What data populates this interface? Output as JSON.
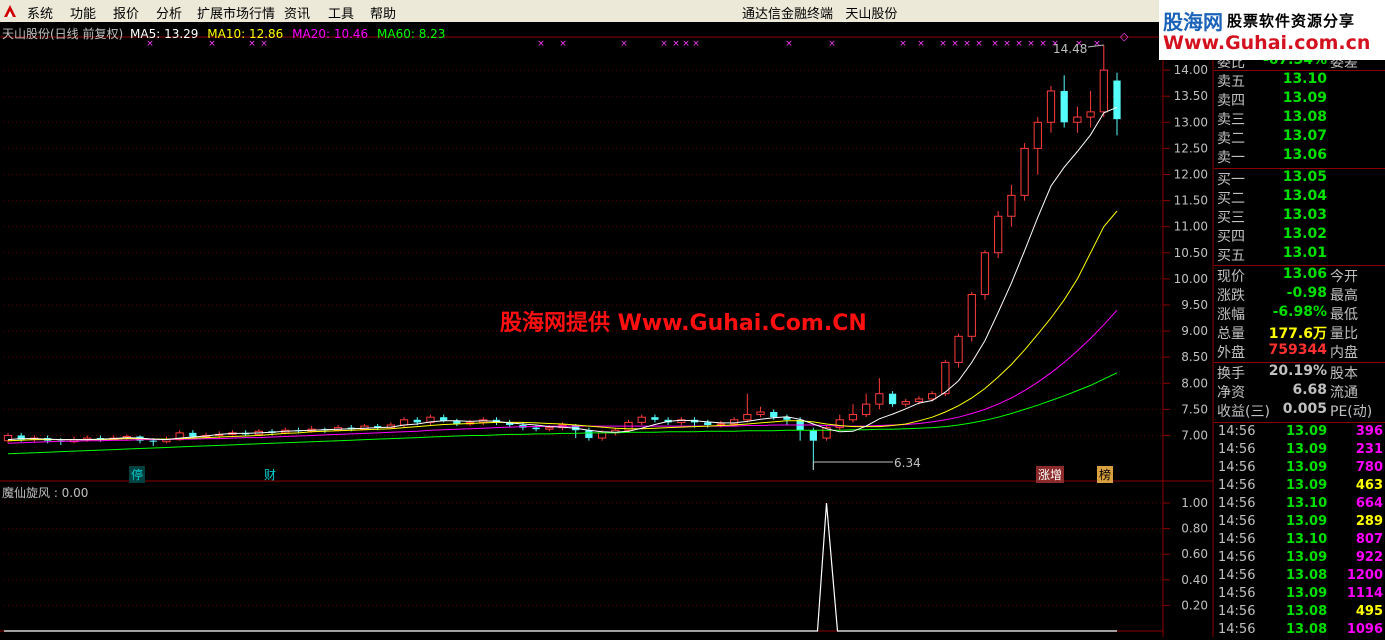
{
  "menu": {
    "items": [
      "系统",
      "功能",
      "报价",
      "分析",
      "扩展市场行情",
      "资讯",
      "工具",
      "帮助"
    ],
    "app_title": "通达信金融终端",
    "stock_name": "天山股份"
  },
  "brand": {
    "line1": "股海网",
    "line2": "股票软件资源分享",
    "line3": "Www.Guhai.com.cn"
  },
  "watermark": "股海网提供 Www.Guhai.Com.CN",
  "chart_header": {
    "title": "天山股份(日线 前复权)",
    "ma5": "MA5: 13.29",
    "ma10": "MA10: 12.86",
    "ma20": "MA20: 10.46",
    "ma60": "MA60: 8.23",
    "ma5_color": "#ffffff",
    "ma10_color": "#ffff00",
    "ma20_color": "#ff00ff",
    "ma60_color": "#00ff00"
  },
  "annotations": {
    "high": "14.48",
    "low": "6.34",
    "tag_ting": "停",
    "tag_cai": "财",
    "tag_zhangzeng": "涨增",
    "tag_bang": "榜"
  },
  "indicator": {
    "title": "魔仙旋风 : 0.00"
  },
  "chart_data": {
    "type": "candlestick",
    "y_axis_price": [
      "14.00",
      "13.50",
      "13.00",
      "12.50",
      "12.00",
      "11.50",
      "11.00",
      "10.50",
      "10.00",
      "9.50",
      "9.00",
      "8.50",
      "8.00",
      "7.50",
      "7.00"
    ],
    "y_axis_indicator": [
      "1.00",
      "0.80",
      "0.60",
      "0.40",
      "0.20"
    ],
    "price_range": [
      6.3,
      14.5
    ],
    "indicator_range": [
      0,
      1.0
    ],
    "candles": [
      [
        6.9,
        7.0,
        6.85,
        7.05
      ],
      [
        7.0,
        6.92,
        6.88,
        7.05
      ],
      [
        6.92,
        6.95,
        6.88,
        7.0
      ],
      [
        6.95,
        6.9,
        6.85,
        7.0
      ],
      [
        6.9,
        6.88,
        6.82,
        6.95
      ],
      [
        6.88,
        6.92,
        6.85,
        6.98
      ],
      [
        6.92,
        6.95,
        6.88,
        7.0
      ],
      [
        6.95,
        6.92,
        6.88,
        7.0
      ],
      [
        6.92,
        6.95,
        6.9,
        7.0
      ],
      [
        6.95,
        6.98,
        6.9,
        7.02
      ],
      [
        6.98,
        6.9,
        6.85,
        7.0
      ],
      [
        6.9,
        6.88,
        6.8,
        6.95
      ],
      [
        6.88,
        6.92,
        6.85,
        6.98
      ],
      [
        6.92,
        7.05,
        6.9,
        7.1
      ],
      [
        7.05,
        6.98,
        6.95,
        7.1
      ],
      [
        6.98,
        7.0,
        6.95,
        7.05
      ],
      [
        7.0,
        7.02,
        6.95,
        7.08
      ],
      [
        7.02,
        7.05,
        7.0,
        7.1
      ],
      [
        7.05,
        7.02,
        6.98,
        7.1
      ],
      [
        7.02,
        7.08,
        7.0,
        7.12
      ],
      [
        7.08,
        7.05,
        7.0,
        7.12
      ],
      [
        7.05,
        7.1,
        7.02,
        7.15
      ],
      [
        7.1,
        7.08,
        7.05,
        7.15
      ],
      [
        7.08,
        7.12,
        7.05,
        7.18
      ],
      [
        7.12,
        7.1,
        7.05,
        7.15
      ],
      [
        7.1,
        7.15,
        7.08,
        7.2
      ],
      [
        7.15,
        7.12,
        7.08,
        7.2
      ],
      [
        7.12,
        7.18,
        7.1,
        7.22
      ],
      [
        7.18,
        7.15,
        7.1,
        7.22
      ],
      [
        7.15,
        7.2,
        7.12,
        7.25
      ],
      [
        7.2,
        7.3,
        7.15,
        7.35
      ],
      [
        7.3,
        7.25,
        7.2,
        7.35
      ],
      [
        7.25,
        7.35,
        7.2,
        7.4
      ],
      [
        7.35,
        7.28,
        7.25,
        7.4
      ],
      [
        7.28,
        7.22,
        7.18,
        7.32
      ],
      [
        7.22,
        7.25,
        7.18,
        7.3
      ],
      [
        7.25,
        7.3,
        7.2,
        7.35
      ],
      [
        7.3,
        7.25,
        7.2,
        7.35
      ],
      [
        7.25,
        7.2,
        7.15,
        7.3
      ],
      [
        7.2,
        7.15,
        7.1,
        7.25
      ],
      [
        7.15,
        7.12,
        7.08,
        7.2
      ],
      [
        7.12,
        7.15,
        7.08,
        7.2
      ],
      [
        7.15,
        7.2,
        7.1,
        7.25
      ],
      [
        7.2,
        7.1,
        6.95,
        7.22
      ],
      [
        7.1,
        6.95,
        6.9,
        7.15
      ],
      [
        6.95,
        7.05,
        6.9,
        7.1
      ],
      [
        7.05,
        7.1,
        7.0,
        7.15
      ],
      [
        7.1,
        7.25,
        7.05,
        7.3
      ],
      [
        7.25,
        7.35,
        7.2,
        7.4
      ],
      [
        7.35,
        7.3,
        7.25,
        7.4
      ],
      [
        7.3,
        7.25,
        7.2,
        7.35
      ],
      [
        7.25,
        7.3,
        7.2,
        7.35
      ],
      [
        7.3,
        7.25,
        7.15,
        7.35
      ],
      [
        7.25,
        7.2,
        7.15,
        7.3
      ],
      [
        7.2,
        7.22,
        7.15,
        7.28
      ],
      [
        7.22,
        7.3,
        7.18,
        7.35
      ],
      [
        7.3,
        7.4,
        7.25,
        7.8
      ],
      [
        7.4,
        7.45,
        7.35,
        7.55
      ],
      [
        7.45,
        7.35,
        7.3,
        7.5
      ],
      [
        7.35,
        7.3,
        7.2,
        7.4
      ],
      [
        7.3,
        7.1,
        6.9,
        7.35
      ],
      [
        7.1,
        6.9,
        6.34,
        7.15
      ],
      [
        6.95,
        7.15,
        6.9,
        7.2
      ],
      [
        7.15,
        7.3,
        7.1,
        7.4
      ],
      [
        7.3,
        7.4,
        7.25,
        7.6
      ],
      [
        7.4,
        7.6,
        7.35,
        7.8
      ],
      [
        7.6,
        7.8,
        7.5,
        8.1
      ],
      [
        7.8,
        7.6,
        7.55,
        7.85
      ],
      [
        7.6,
        7.65,
        7.55,
        7.7
      ],
      [
        7.65,
        7.7,
        7.6,
        7.75
      ],
      [
        7.7,
        7.8,
        7.65,
        7.85
      ],
      [
        7.8,
        8.4,
        7.75,
        8.45
      ],
      [
        8.4,
        8.9,
        8.3,
        8.95
      ],
      [
        8.9,
        9.7,
        8.8,
        9.75
      ],
      [
        9.7,
        10.5,
        9.6,
        10.55
      ],
      [
        10.5,
        11.2,
        10.4,
        11.3
      ],
      [
        11.2,
        11.6,
        11.0,
        11.8
      ],
      [
        11.6,
        12.5,
        11.5,
        12.6
      ],
      [
        12.5,
        13.0,
        12.0,
        13.1
      ],
      [
        13.0,
        13.6,
        12.8,
        13.7
      ],
      [
        13.6,
        13.0,
        12.9,
        13.9
      ],
      [
        13.0,
        13.1,
        12.8,
        13.3
      ],
      [
        13.1,
        13.2,
        12.9,
        13.6
      ],
      [
        13.2,
        14.0,
        13.1,
        14.48
      ],
      [
        13.8,
        13.06,
        12.75,
        13.95
      ]
    ],
    "ma5": [
      6.92,
      6.94,
      6.94,
      6.93,
      6.92,
      6.92,
      6.92,
      6.93,
      6.94,
      6.96,
      6.95,
      6.93,
      6.92,
      6.95,
      6.97,
      6.99,
      7.02,
      7.04,
      7.04,
      7.05,
      7.06,
      7.08,
      7.09,
      7.1,
      7.11,
      7.12,
      7.13,
      7.14,
      7.15,
      7.16,
      7.2,
      7.22,
      7.26,
      7.28,
      7.28,
      7.27,
      7.28,
      7.27,
      7.24,
      7.22,
      7.2,
      7.17,
      7.16,
      7.14,
      7.1,
      7.07,
      7.06,
      7.08,
      7.14,
      7.21,
      7.27,
      7.29,
      7.28,
      7.26,
      7.24,
      7.24,
      7.27,
      7.31,
      7.34,
      7.36,
      7.31,
      7.22,
      7.13,
      7.07,
      7.08,
      7.18,
      7.32,
      7.41,
      7.51,
      7.62,
      7.67,
      7.83,
      8.05,
      8.4,
      8.82,
      9.36,
      9.92,
      10.54,
      11.18,
      11.78,
      12.14,
      12.44,
      12.76,
      13.18,
      13.29
    ],
    "ma10": [
      6.9,
      6.91,
      6.92,
      6.92,
      6.92,
      6.92,
      6.92,
      6.92,
      6.93,
      6.94,
      6.94,
      6.93,
      6.93,
      6.94,
      6.95,
      6.96,
      6.97,
      6.98,
      6.99,
      7.0,
      7.02,
      7.04,
      7.05,
      7.07,
      7.08,
      7.09,
      7.1,
      7.11,
      7.12,
      7.13,
      7.15,
      7.17,
      7.19,
      7.21,
      7.22,
      7.23,
      7.24,
      7.25,
      7.25,
      7.25,
      7.24,
      7.23,
      7.22,
      7.2,
      7.18,
      7.16,
      7.14,
      7.13,
      7.13,
      7.14,
      7.15,
      7.16,
      7.17,
      7.18,
      7.19,
      7.2,
      7.22,
      7.24,
      7.26,
      7.28,
      7.28,
      7.26,
      7.22,
      7.19,
      7.17,
      7.17,
      7.17,
      7.19,
      7.22,
      7.28,
      7.35,
      7.45,
      7.57,
      7.72,
      7.9,
      8.12,
      8.36,
      8.64,
      8.94,
      9.25,
      9.6,
      10.0,
      10.5,
      11.0,
      11.3
    ],
    "ma20": [
      6.85,
      6.86,
      6.87,
      6.88,
      6.89,
      6.89,
      6.9,
      6.9,
      6.91,
      6.91,
      6.92,
      6.92,
      6.92,
      6.93,
      6.93,
      6.94,
      6.94,
      6.95,
      6.96,
      6.96,
      6.97,
      6.98,
      6.99,
      7.0,
      7.01,
      7.02,
      7.03,
      7.04,
      7.05,
      7.06,
      7.07,
      7.08,
      7.1,
      7.11,
      7.12,
      7.13,
      7.14,
      7.15,
      7.16,
      7.17,
      7.17,
      7.18,
      7.18,
      7.18,
      7.18,
      7.18,
      7.18,
      7.18,
      7.18,
      7.18,
      7.18,
      7.18,
      7.18,
      7.18,
      7.18,
      7.18,
      7.19,
      7.19,
      7.2,
      7.2,
      7.2,
      7.2,
      7.19,
      7.18,
      7.18,
      7.18,
      7.19,
      7.2,
      7.21,
      7.23,
      7.26,
      7.3,
      7.35,
      7.42,
      7.5,
      7.6,
      7.72,
      7.86,
      8.02,
      8.2,
      8.4,
      8.62,
      8.86,
      9.12,
      9.4
    ],
    "ma60": [
      6.65,
      6.66,
      6.67,
      6.68,
      6.69,
      6.7,
      6.71,
      6.72,
      6.73,
      6.74,
      6.75,
      6.76,
      6.77,
      6.78,
      6.79,
      6.8,
      6.81,
      6.82,
      6.83,
      6.84,
      6.85,
      6.86,
      6.87,
      6.88,
      6.89,
      6.9,
      6.91,
      6.92,
      6.93,
      6.94,
      6.95,
      6.96,
      6.97,
      6.98,
      6.99,
      7.0,
      7.0,
      7.01,
      7.02,
      7.02,
      7.03,
      7.03,
      7.04,
      7.04,
      7.05,
      7.05,
      7.05,
      7.06,
      7.06,
      7.06,
      7.07,
      7.07,
      7.07,
      7.08,
      7.08,
      7.08,
      7.09,
      7.09,
      7.09,
      7.1,
      7.1,
      7.1,
      7.1,
      7.1,
      7.11,
      7.11,
      7.12,
      7.12,
      7.13,
      7.14,
      7.15,
      7.17,
      7.2,
      7.24,
      7.29,
      7.35,
      7.42,
      7.5,
      7.58,
      7.67,
      7.76,
      7.86,
      7.96,
      8.08,
      8.2
    ],
    "indicator": [
      0,
      0,
      0,
      0,
      0,
      0,
      0,
      0,
      0,
      0,
      0,
      0,
      0,
      0,
      0,
      0,
      0,
      0,
      0,
      0,
      0,
      0,
      0,
      0,
      0,
      0,
      0,
      0,
      0,
      0,
      0,
      0,
      0,
      0,
      0,
      0,
      0,
      0,
      0,
      0,
      0,
      0,
      0,
      0,
      0,
      0,
      0,
      0,
      0,
      0,
      0,
      0,
      0,
      0,
      0,
      0,
      0,
      0,
      0,
      0,
      0,
      0,
      0,
      0,
      0,
      0,
      0,
      0,
      0,
      0,
      0,
      0,
      0,
      0,
      0,
      0,
      0,
      0,
      0,
      0,
      1,
      0,
      0,
      0,
      0
    ],
    "indicator_peak_index": 62
  },
  "quote": {
    "weibi": {
      "label": "委比",
      "value": "-67.54%",
      "right": "委差",
      "color": "#00e000"
    },
    "asks": [
      {
        "label": "卖五",
        "value": "13.10"
      },
      {
        "label": "卖四",
        "value": "13.09"
      },
      {
        "label": "卖三",
        "value": "13.08"
      },
      {
        "label": "卖二",
        "value": "13.07"
      },
      {
        "label": "卖一",
        "value": "13.06"
      }
    ],
    "bids": [
      {
        "label": "买一",
        "value": "13.05"
      },
      {
        "label": "买二",
        "value": "13.04"
      },
      {
        "label": "买三",
        "value": "13.03"
      },
      {
        "label": "买四",
        "value": "13.02"
      },
      {
        "label": "买五",
        "value": "13.01"
      }
    ],
    "stats1": [
      {
        "label": "现价",
        "value": "13.06",
        "right": "今开",
        "color": "#00e000"
      },
      {
        "label": "涨跌",
        "value": "-0.98",
        "right": "最高",
        "color": "#00e000"
      },
      {
        "label": "涨幅",
        "value": "-6.98%",
        "right": "最低",
        "color": "#00e000"
      },
      {
        "label": "总量",
        "value": "177.6万",
        "right": "量比",
        "color": "#ffff00"
      },
      {
        "label": "外盘",
        "value": "759344",
        "right": "内盘",
        "color": "#ff3030"
      }
    ],
    "stats2": [
      {
        "label": "换手",
        "value": "20.19%",
        "right": "股本",
        "color": "#c0c0c0"
      },
      {
        "label": "净资",
        "value": "6.68",
        "right": "流通",
        "color": "#c0c0c0"
      },
      {
        "label": "收益(三)",
        "value": "0.005",
        "right": "PE(动)",
        "color": "#c0c0c0"
      }
    ],
    "ticks": [
      {
        "time": "14:56",
        "price": "13.09",
        "vol": "396",
        "color": "#ff00ff"
      },
      {
        "time": "14:56",
        "price": "13.09",
        "vol": "231",
        "color": "#ff00ff"
      },
      {
        "time": "14:56",
        "price": "13.09",
        "vol": "780",
        "color": "#ff00ff"
      },
      {
        "time": "14:56",
        "price": "13.09",
        "vol": "463",
        "color": "#ffff00"
      },
      {
        "time": "14:56",
        "price": "13.10",
        "vol": "664",
        "color": "#ff00ff"
      },
      {
        "time": "14:56",
        "price": "13.09",
        "vol": "289",
        "color": "#ffff00"
      },
      {
        "time": "14:56",
        "price": "13.10",
        "vol": "807",
        "color": "#ff00ff"
      },
      {
        "time": "14:56",
        "price": "13.09",
        "vol": "922",
        "color": "#ff00ff"
      },
      {
        "time": "14:56",
        "price": "13.08",
        "vol": "1200",
        "color": "#ff00ff"
      },
      {
        "time": "14:56",
        "price": "13.09",
        "vol": "1114",
        "color": "#ff00ff"
      },
      {
        "time": "14:56",
        "price": "13.08",
        "vol": "495",
        "color": "#ffff00"
      },
      {
        "time": "14:56",
        "price": "13.08",
        "vol": "1096",
        "color": "#ff00ff"
      }
    ]
  }
}
